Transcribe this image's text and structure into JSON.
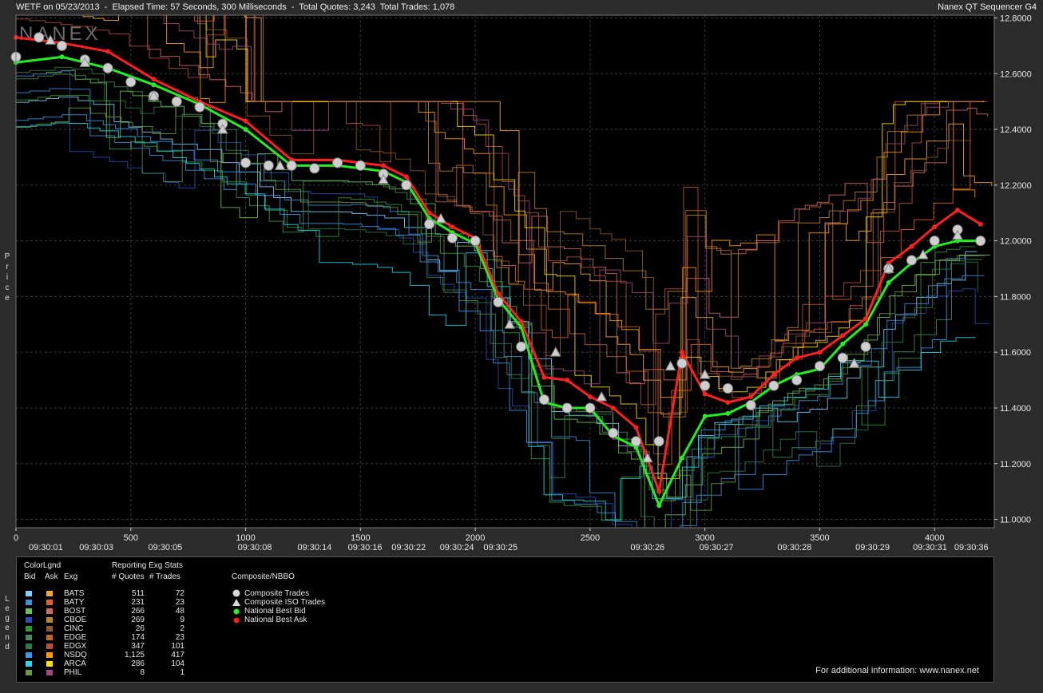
{
  "header": {
    "left_text": "WETF on 05/23/2013  -  Elapsed Time: 57 Seconds, 300 Milliseconds  -  Total Quotes: 3,243  Total Trades: 1,078",
    "right_text": "Nanex QT Sequencer G4",
    "watermark": "NANEX"
  },
  "axis_labels": {
    "y_side": "Price",
    "legend_side": "Legend"
  },
  "chart_data": {
    "type": "line",
    "title": "WETF on 05/23/2013",
    "ylabel": "Price",
    "xlabel": "",
    "ylim": [
      10.97,
      12.81
    ],
    "xlim": [
      0,
      4260
    ],
    "y_ticks": [
      "11.0000",
      "11.2000",
      "11.4000",
      "11.6000",
      "11.8000",
      "12.0000",
      "12.2000",
      "12.4000",
      "12.6000",
      "12.8000"
    ],
    "x_ticks": [
      "0",
      "500",
      "1000",
      "1500",
      "2000",
      "2500",
      "3000",
      "3500",
      "4000"
    ],
    "time_labels": [
      {
        "x": 130,
        "label": "09:30:01"
      },
      {
        "x": 350,
        "label": "09:30:03"
      },
      {
        "x": 650,
        "label": "09:30:05"
      },
      {
        "x": 1040,
        "label": "09:30:08"
      },
      {
        "x": 1300,
        "label": "09:30:14"
      },
      {
        "x": 1520,
        "label": "09:30:16"
      },
      {
        "x": 1710,
        "label": "09:30:22"
      },
      {
        "x": 1920,
        "label": "09:30:24"
      },
      {
        "x": 2110,
        "label": "09:30:25"
      },
      {
        "x": 2750,
        "label": "09:30:26"
      },
      {
        "x": 3050,
        "label": "09:30:27"
      },
      {
        "x": 3390,
        "label": "09:30:28"
      },
      {
        "x": 3730,
        "label": "09:30:29"
      },
      {
        "x": 3980,
        "label": "09:30:31"
      },
      {
        "x": 4160,
        "label": "09:30:36"
      }
    ],
    "series": [
      {
        "name": "National Best Bid",
        "x": [
          0,
          200,
          400,
          600,
          800,
          1000,
          1200,
          1400,
          1600,
          1700,
          1800,
          1900,
          2000,
          2100,
          2200,
          2300,
          2400,
          2500,
          2600,
          2700,
          2800,
          2900,
          3000,
          3100,
          3200,
          3300,
          3400,
          3500,
          3600,
          3700,
          3800,
          3900,
          4000,
          4100,
          4200
        ],
        "y": [
          12.64,
          12.66,
          12.62,
          12.56,
          12.49,
          12.4,
          12.27,
          12.27,
          12.25,
          12.21,
          12.08,
          12.03,
          11.99,
          11.79,
          11.69,
          11.42,
          11.4,
          11.4,
          11.3,
          11.26,
          11.05,
          11.22,
          11.37,
          11.38,
          11.42,
          11.48,
          11.52,
          11.54,
          11.63,
          11.7,
          11.85,
          11.92,
          11.98,
          12.0,
          12.0
        ]
      },
      {
        "name": "National Best Ask",
        "x": [
          0,
          200,
          400,
          600,
          800,
          1000,
          1200,
          1400,
          1600,
          1700,
          1800,
          1900,
          2000,
          2100,
          2200,
          2300,
          2400,
          2500,
          2600,
          2700,
          2800,
          2900,
          3000,
          3100,
          3200,
          3300,
          3400,
          3500,
          3600,
          3700,
          3800,
          3900,
          4000,
          4100,
          4200
        ],
        "y": [
          12.73,
          12.71,
          12.68,
          12.58,
          12.5,
          12.43,
          12.29,
          12.29,
          12.27,
          12.23,
          12.1,
          12.05,
          12.01,
          11.81,
          11.71,
          11.51,
          11.5,
          11.44,
          11.4,
          11.33,
          11.1,
          11.6,
          11.45,
          11.42,
          11.44,
          11.52,
          11.58,
          11.6,
          11.66,
          11.72,
          11.92,
          11.98,
          12.05,
          12.11,
          12.06
        ]
      },
      {
        "name": "Composite Trades",
        "x": [
          0,
          100,
          200,
          300,
          400,
          500,
          600,
          700,
          800,
          900,
          1000,
          1100,
          1200,
          1300,
          1400,
          1500,
          1600,
          1700,
          1800,
          1900,
          2000,
          2100,
          2200,
          2300,
          2400,
          2500,
          2600,
          2700,
          2800,
          2900,
          3000,
          3100,
          3200,
          3300,
          3400,
          3500,
          3600,
          3700,
          3800,
          3900,
          4000,
          4100,
          4200
        ],
        "y": [
          12.66,
          12.73,
          12.7,
          12.65,
          12.62,
          12.57,
          12.52,
          12.5,
          12.48,
          12.42,
          12.28,
          12.27,
          12.27,
          12.26,
          12.28,
          12.27,
          12.24,
          12.2,
          12.06,
          12.01,
          12.0,
          11.78,
          11.62,
          11.43,
          11.4,
          11.4,
          11.31,
          11.28,
          11.28,
          11.56,
          11.48,
          11.47,
          11.41,
          11.48,
          11.5,
          11.55,
          11.58,
          11.62,
          11.9,
          11.93,
          12.0,
          12.04,
          12.0
        ]
      },
      {
        "name": "Composite ISO Trades",
        "x": [
          150,
          300,
          600,
          900,
          1150,
          1600,
          1850,
          2150,
          2350,
          2550,
          2750,
          2850,
          3000,
          3650,
          3800,
          3950,
          4100
        ],
        "y": [
          12.72,
          12.64,
          12.52,
          12.4,
          12.27,
          12.22,
          12.08,
          11.7,
          11.6,
          11.44,
          11.22,
          11.55,
          11.52,
          11.56,
          11.9,
          11.95,
          12.02
        ]
      }
    ]
  },
  "legend": {
    "headers": {
      "colorlgnd": "ColorLgnd",
      "bid": "Bid",
      "ask": "Ask",
      "exg": "Exg",
      "reporting": "Reporting Exg Stats",
      "quotes": "# Quotes",
      "trades": "# Trades",
      "composite": "Composite/NBBO"
    },
    "exchanges": [
      {
        "exg": "BATS",
        "quotes": "511",
        "trades": "72",
        "bid_color": "#7fd0ff",
        "ask_color": "#f2a83a"
      },
      {
        "exg": "BATY",
        "quotes": "231",
        "trades": "23",
        "bid_color": "#3f8fd8",
        "ask_color": "#e0602a"
      },
      {
        "exg": "BOST",
        "quotes": "266",
        "trades": "48",
        "bid_color": "#6fbf5f",
        "ask_color": "#d06a6a"
      },
      {
        "exg": "CBOE",
        "quotes": "269",
        "trades": "9",
        "bid_color": "#2a4fb0",
        "ask_color": "#b8862a"
      },
      {
        "exg": "CINC",
        "quotes": "26",
        "trades": "2",
        "bid_color": "#2f9a2f",
        "ask_color": "#8a5a2a"
      },
      {
        "exg": "EDGE",
        "quotes": "174",
        "trades": "23",
        "bid_color": "#4a8a5a",
        "ask_color": "#c06a2a"
      },
      {
        "exg": "EDGX",
        "quotes": "347",
        "trades": "101",
        "bid_color": "#2a7a4a",
        "ask_color": "#b8503a"
      },
      {
        "exg": "NSDQ",
        "quotes": "1,125",
        "trades": "417",
        "bid_color": "#3a9ae8",
        "ask_color": "#ff9a00"
      },
      {
        "exg": "ARCA",
        "quotes": "286",
        "trades": "104",
        "bid_color": "#20d8f0",
        "ask_color": "#ffe000"
      },
      {
        "exg": "PHIL",
        "quotes": "8",
        "trades": "1",
        "bid_color": "#6a9a3a",
        "ask_color": "#a04a7a"
      }
    ],
    "composite_items": [
      {
        "label": "Composite Trades",
        "icon": "circle-icon",
        "color": "#d8d8d8"
      },
      {
        "label": "Composite ISO Trades",
        "icon": "triangle-icon",
        "color": "#d8d8d8"
      },
      {
        "label": "National Best Bid",
        "icon": "dot-icon",
        "color": "#22ee22"
      },
      {
        "label": "National Best Ask",
        "icon": "dot-icon",
        "color": "#ff2020"
      }
    ],
    "footer": "For additional information: www.nanex.net"
  },
  "colors": {
    "background": "#000000",
    "grid": "#3a3a3a",
    "bid": "#22ee22",
    "ask": "#ff2020",
    "trade": "#cfcfcf"
  }
}
